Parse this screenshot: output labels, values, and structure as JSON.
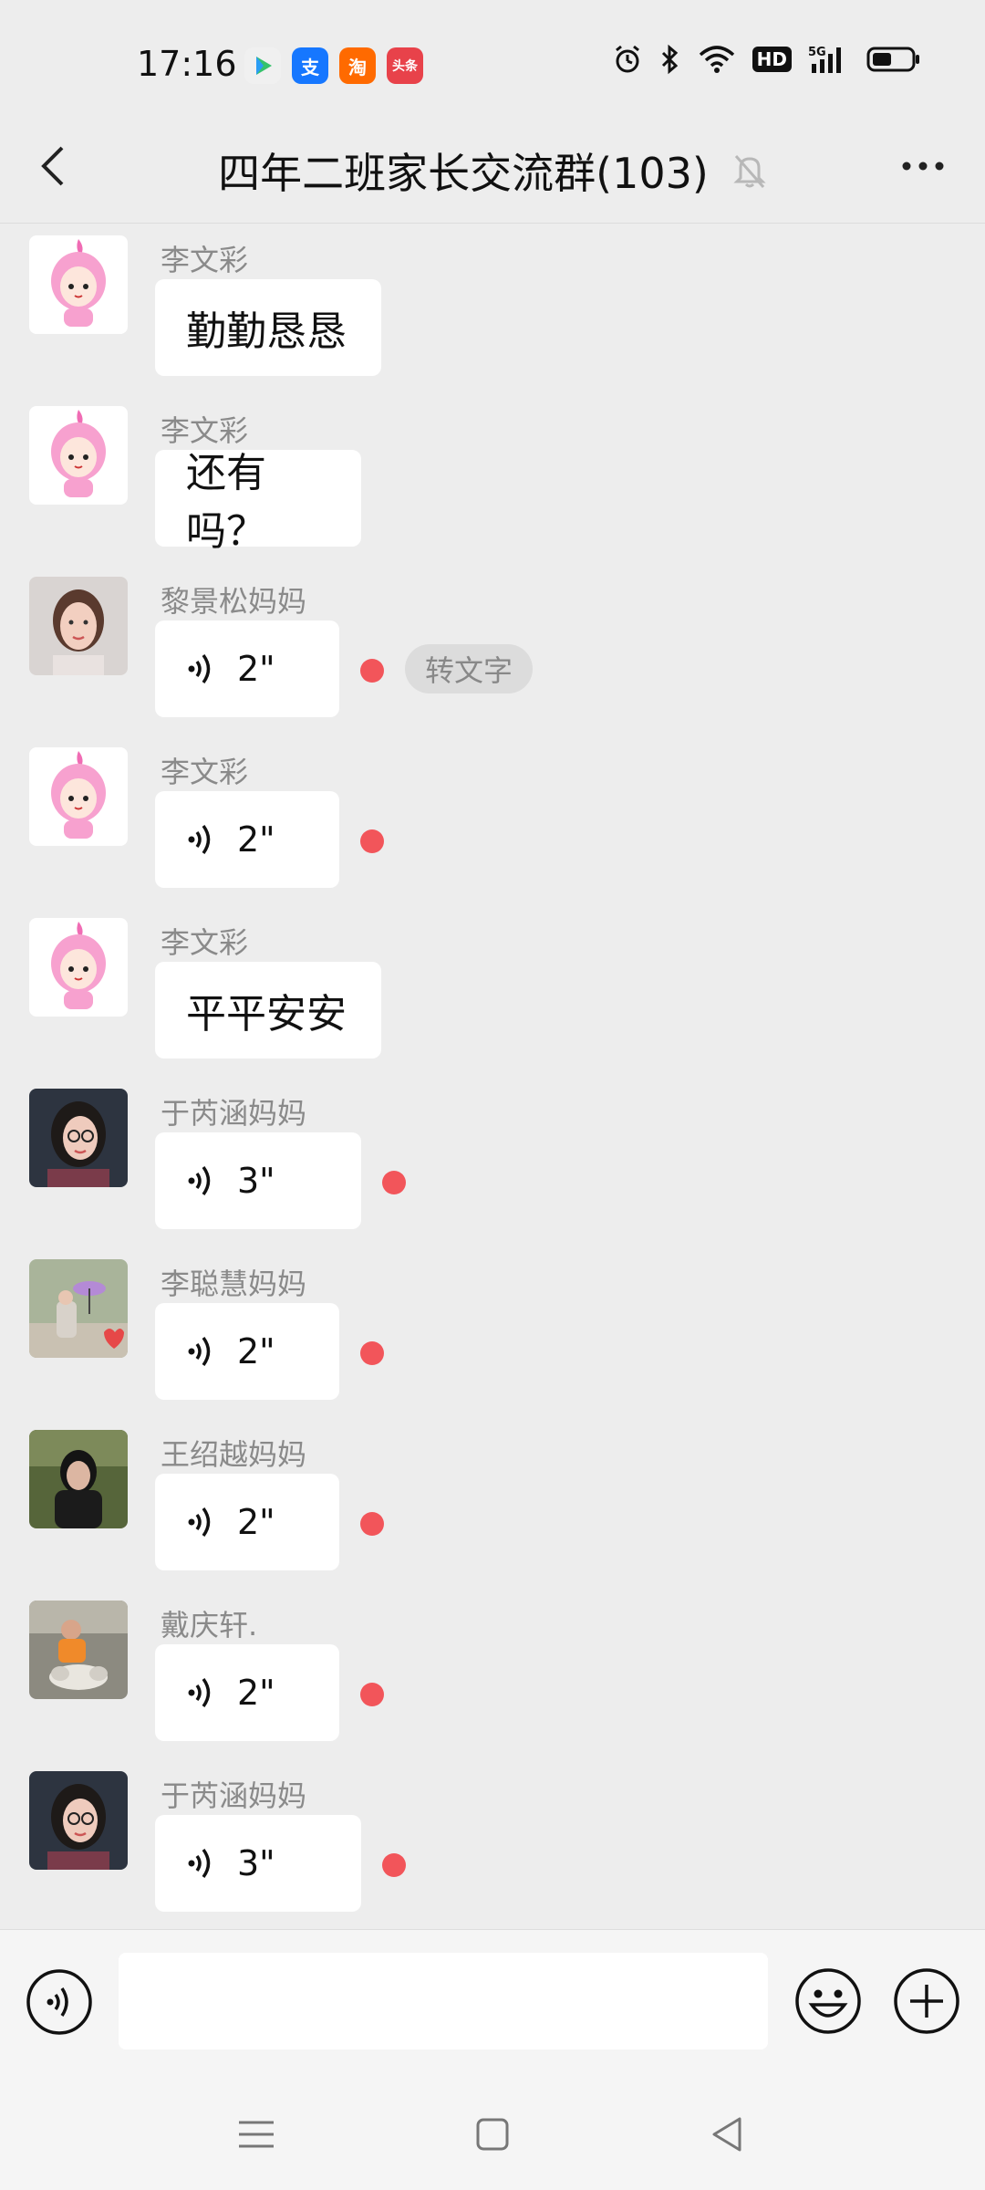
{
  "status_bar": {
    "time": "17:16",
    "app_icons": [
      {
        "icon": "play-app-icon",
        "label": "▶",
        "color": "#ffffff"
      },
      {
        "icon": "alipay-icon",
        "label": "支",
        "color": "#1677ff"
      },
      {
        "icon": "taobao-icon",
        "label": "淘",
        "color": "#ff6a00"
      },
      {
        "icon": "toutiao-icon",
        "label": "头条",
        "color": "#e8424a"
      }
    ],
    "hd_label": "HD",
    "network": "5G"
  },
  "header": {
    "title": "四年二班家长交流群(103)"
  },
  "messages": [
    {
      "sender": "李文彩",
      "type": "text",
      "content": "勤勤恳恳",
      "avatar": "pink-cartoon"
    },
    {
      "sender": "李文彩",
      "type": "text",
      "content": "还有吗？",
      "avatar": "pink-cartoon"
    },
    {
      "sender": "黎景松妈妈",
      "type": "voice",
      "content": "2\"",
      "avatar": "photo-woman",
      "convert_label": "转文字"
    },
    {
      "sender": "李文彩",
      "type": "voice",
      "content": "2\"",
      "avatar": "pink-cartoon"
    },
    {
      "sender": "李文彩",
      "type": "text",
      "content": "平平安安",
      "avatar": "pink-cartoon"
    },
    {
      "sender": "于芮涵妈妈",
      "type": "voice",
      "content": "3\"",
      "avatar": "photo-glasses"
    },
    {
      "sender": "李聪慧妈妈",
      "type": "voice",
      "content": "2\"",
      "avatar": "photo-outdoor"
    },
    {
      "sender": "王绍越妈妈",
      "type": "voice",
      "content": "2\"",
      "avatar": "photo-dark"
    },
    {
      "sender": "戴庆轩.",
      "type": "voice",
      "content": "2\"",
      "avatar": "photo-kid"
    },
    {
      "sender": "于芮涵妈妈",
      "type": "voice",
      "content": "3\"",
      "avatar": "photo-glasses"
    }
  ],
  "colors": {
    "unread_dot": "#f2555a",
    "background": "#ededed"
  }
}
